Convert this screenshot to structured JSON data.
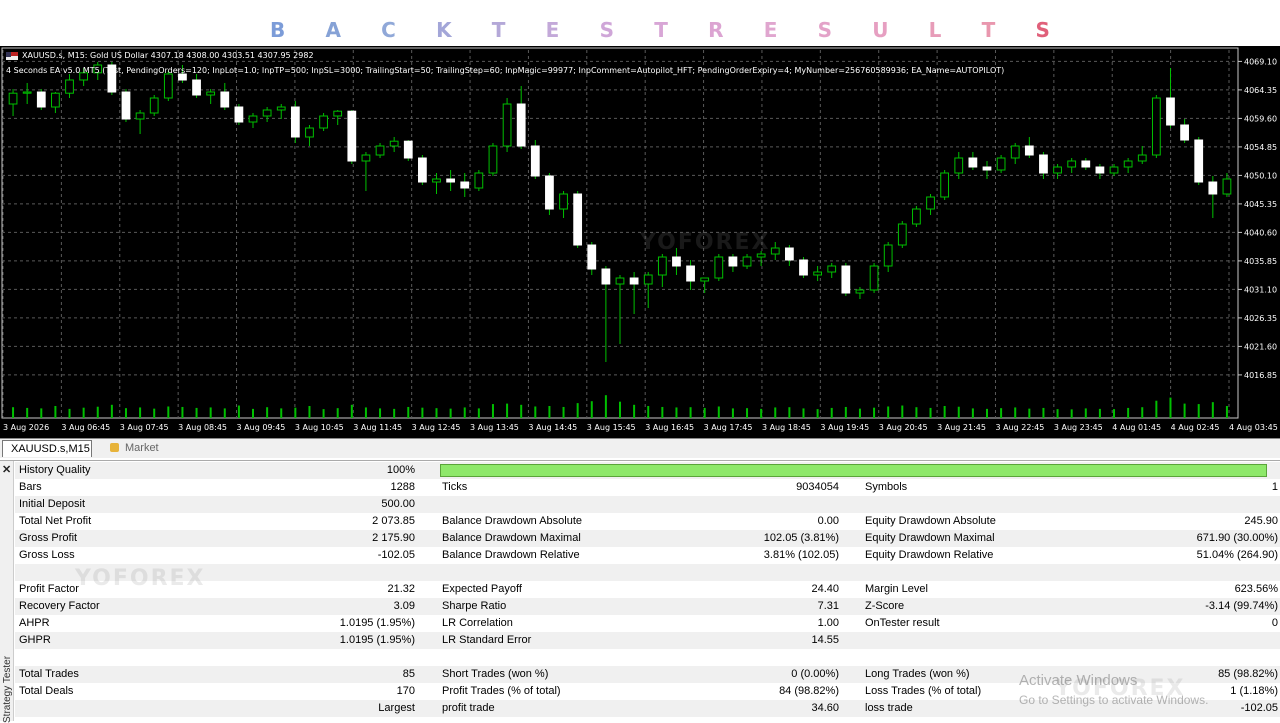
{
  "banner": {
    "letters": [
      "B",
      "A",
      "C",
      "K",
      "T",
      "E",
      "S",
      "T",
      "R",
      "E",
      "S",
      "U",
      "L",
      "T",
      "S"
    ],
    "colors": [
      "#7c9cd8",
      "#86a2d6",
      "#90a8d8",
      "#a3a6d8",
      "#b4a8d8",
      "#c3a9d9",
      "#cfa6d8",
      "#d8a6d6",
      "#dca4d2",
      "#e0a6cf",
      "#e3a2c8",
      "#e69fc1",
      "#e79cb8",
      "#e997ae",
      "#e0607a"
    ]
  },
  "chart_header": {
    "line1": "XAUUSD.s, M15:  Gold US Dollar  4307.18 4308.00 4303.51 4307.95  2982",
    "line2": "4 Seconds EA v5.0 MT5 (Test, PendingOrders=120; InpLot=1.0; InpTP=500; InpSL=3000; TrailingStart=50; TrailingStep=60; InpMagic=99977; InpComment=Autopilot_HFT; PendingOrderExpiry=4; MyNumber=256760589936; EA_Name=AUTOPILOT)"
  },
  "chart_data": {
    "type": "candlestick",
    "symbol": "XAUUSD.s",
    "timeframe": "M15",
    "ylim": [
      4014,
      4071
    ],
    "y_ticks": [
      "4069.10",
      "4064.35",
      "4059.60",
      "4054.85",
      "4050.10",
      "4045.35",
      "4040.60",
      "4035.85",
      "4031.10",
      "4026.35",
      "4021.60",
      "4016.85"
    ],
    "x_ticks": [
      "3 Aug 2026",
      "3 Aug 06:45",
      "3 Aug 07:45",
      "3 Aug 08:45",
      "3 Aug 09:45",
      "3 Aug 10:45",
      "3 Aug 11:45",
      "3 Aug 12:45",
      "3 Aug 13:45",
      "3 Aug 14:45",
      "3 Aug 15:45",
      "3 Aug 16:45",
      "3 Aug 17:45",
      "3 Aug 18:45",
      "3 Aug 19:45",
      "3 Aug 20:45",
      "3 Aug 21:45",
      "3 Aug 22:45",
      "3 Aug 23:45",
      "4 Aug 01:45",
      "4 Aug 02:45",
      "4 Aug 03:45"
    ],
    "bull_color": "#00c000",
    "bear_color": "#ffffff",
    "candles": [
      [
        4062.0,
        4064.5,
        4060.0,
        4063.8
      ],
      [
        4063.8,
        4065.5,
        4062.0,
        4064.0
      ],
      [
        4064.0,
        4064.5,
        4061.0,
        4061.5
      ],
      [
        4061.5,
        4064.0,
        4060.5,
        4063.8
      ],
      [
        4063.8,
        4067.0,
        4063.0,
        4066.0
      ],
      [
        4066.0,
        4068.0,
        4065.0,
        4067.2
      ],
      [
        4067.2,
        4069.0,
        4066.0,
        4068.5
      ],
      [
        4068.5,
        4069.0,
        4063.5,
        4064.0
      ],
      [
        4064.0,
        4064.5,
        4059.0,
        4059.5
      ],
      [
        4059.5,
        4061.0,
        4057.0,
        4060.5
      ],
      [
        4060.5,
        4063.5,
        4060.0,
        4063.0
      ],
      [
        4063.0,
        4067.5,
        4062.5,
        4067.0
      ],
      [
        4067.0,
        4068.5,
        4065.5,
        4066.0
      ],
      [
        4066.0,
        4067.0,
        4063.0,
        4063.5
      ],
      [
        4063.5,
        4064.5,
        4062.0,
        4064.0
      ],
      [
        4064.0,
        4065.5,
        4061.0,
        4061.5
      ],
      [
        4061.5,
        4062.0,
        4058.5,
        4059.0
      ],
      [
        4059.0,
        4060.5,
        4058.0,
        4060.0
      ],
      [
        4060.0,
        4061.5,
        4059.0,
        4061.0
      ],
      [
        4061.0,
        4062.0,
        4059.5,
        4061.5
      ],
      [
        4061.5,
        4062.5,
        4055.5,
        4056.5
      ],
      [
        4056.5,
        4058.5,
        4055.0,
        4058.0
      ],
      [
        4058.0,
        4060.5,
        4057.5,
        4060.0
      ],
      [
        4060.0,
        4061.0,
        4058.5,
        4060.8
      ],
      [
        4060.8,
        4061.0,
        4052.0,
        4052.5
      ],
      [
        4052.5,
        4054.0,
        4047.5,
        4053.5
      ],
      [
        4053.5,
        4055.5,
        4053.0,
        4055.0
      ],
      [
        4055.0,
        4056.5,
        4054.0,
        4055.8
      ],
      [
        4055.8,
        4056.0,
        4052.5,
        4053.0
      ],
      [
        4053.0,
        4053.5,
        4048.5,
        4049.0
      ],
      [
        4049.0,
        4050.5,
        4047.0,
        4049.5
      ],
      [
        4049.5,
        4051.0,
        4047.5,
        4049.0
      ],
      [
        4049.0,
        4050.5,
        4046.5,
        4048.0
      ],
      [
        4048.0,
        4051.0,
        4047.5,
        4050.5
      ],
      [
        4050.5,
        4055.5,
        4050.0,
        4055.0
      ],
      [
        4055.0,
        4063.0,
        4054.0,
        4062.0
      ],
      [
        4062.0,
        4065.0,
        4054.5,
        4055.0
      ],
      [
        4055.0,
        4056.0,
        4049.5,
        4050.0
      ],
      [
        4050.0,
        4050.5,
        4043.5,
        4044.5
      ],
      [
        4044.5,
        4047.5,
        4043.0,
        4047.0
      ],
      [
        4047.0,
        4047.5,
        4038.0,
        4038.5
      ],
      [
        4038.5,
        4039.0,
        4033.5,
        4034.5
      ],
      [
        4034.5,
        4035.0,
        4019.0,
        4032.0
      ],
      [
        4032.0,
        4033.5,
        4022.0,
        4033.0
      ],
      [
        4033.0,
        4034.0,
        4027.0,
        4032.0
      ],
      [
        4032.0,
        4034.0,
        4028.0,
        4033.5
      ],
      [
        4033.5,
        4037.0,
        4031.5,
        4036.5
      ],
      [
        4036.5,
        4038.0,
        4033.5,
        4035.0
      ],
      [
        4035.0,
        4036.0,
        4031.0,
        4032.5
      ],
      [
        4032.5,
        4033.0,
        4030.5,
        4033.0
      ],
      [
        4033.0,
        4037.0,
        4032.5,
        4036.5
      ],
      [
        4036.5,
        4037.0,
        4034.0,
        4035.0
      ],
      [
        4035.0,
        4037.0,
        4034.5,
        4036.5
      ],
      [
        4036.5,
        4037.5,
        4035.0,
        4037.0
      ],
      [
        4037.0,
        4039.0,
        4036.0,
        4038.0
      ],
      [
        4038.0,
        4038.5,
        4035.0,
        4036.0
      ],
      [
        4036.0,
        4036.5,
        4033.0,
        4033.5
      ],
      [
        4033.5,
        4035.0,
        4032.5,
        4034.0
      ],
      [
        4034.0,
        4035.5,
        4033.0,
        4035.0
      ],
      [
        4035.0,
        4035.5,
        4030.0,
        4030.5
      ],
      [
        4030.5,
        4031.5,
        4029.5,
        4031.0
      ],
      [
        4031.0,
        4035.5,
        4030.5,
        4035.0
      ],
      [
        4035.0,
        4039.0,
        4034.0,
        4038.5
      ],
      [
        4038.5,
        4042.5,
        4038.0,
        4042.0
      ],
      [
        4042.0,
        4045.0,
        4041.5,
        4044.5
      ],
      [
        4044.5,
        4047.0,
        4043.5,
        4046.5
      ],
      [
        4046.5,
        4051.0,
        4046.0,
        4050.5
      ],
      [
        4050.5,
        4054.0,
        4049.5,
        4053.0
      ],
      [
        4053.0,
        4054.0,
        4051.0,
        4051.5
      ],
      [
        4051.5,
        4052.5,
        4049.5,
        4051.0
      ],
      [
        4051.0,
        4053.5,
        4050.5,
        4053.0
      ],
      [
        4053.0,
        4055.5,
        4052.0,
        4055.0
      ],
      [
        4055.0,
        4056.5,
        4053.0,
        4053.5
      ],
      [
        4053.5,
        4054.0,
        4049.5,
        4050.5
      ],
      [
        4050.5,
        4052.0,
        4049.5,
        4051.5
      ],
      [
        4051.5,
        4053.0,
        4050.5,
        4052.5
      ],
      [
        4052.5,
        4053.0,
        4051.0,
        4051.5
      ],
      [
        4051.5,
        4052.0,
        4049.5,
        4050.5
      ],
      [
        4050.5,
        4052.0,
        4050.0,
        4051.5
      ],
      [
        4051.5,
        4053.0,
        4050.5,
        4052.5
      ],
      [
        4052.5,
        4055.0,
        4052.0,
        4053.5
      ],
      [
        4053.5,
        4063.5,
        4053.0,
        4063.0
      ],
      [
        4063.0,
        4068.0,
        4058.0,
        4058.5
      ],
      [
        4058.5,
        4059.5,
        4055.5,
        4056.0
      ],
      [
        4056.0,
        4056.5,
        4048.5,
        4049.0
      ],
      [
        4049.0,
        4050.0,
        4043.0,
        4047.0
      ],
      [
        4047.0,
        4050.5,
        4046.5,
        4049.5
      ]
    ],
    "volumes": [
      0.45,
      0.42,
      0.4,
      0.5,
      0.38,
      0.43,
      0.47,
      0.55,
      0.41,
      0.44,
      0.39,
      0.48,
      0.46,
      0.42,
      0.44,
      0.4,
      0.52,
      0.38,
      0.45,
      0.4,
      0.43,
      0.5,
      0.37,
      0.41,
      0.55,
      0.44,
      0.4,
      0.38,
      0.46,
      0.43,
      0.41,
      0.39,
      0.44,
      0.4,
      0.58,
      0.6,
      0.55,
      0.48,
      0.5,
      0.46,
      0.62,
      0.7,
      0.95,
      0.68,
      0.55,
      0.5,
      0.46,
      0.44,
      0.45,
      0.42,
      0.48,
      0.4,
      0.41,
      0.38,
      0.44,
      0.45,
      0.4,
      0.37,
      0.42,
      0.46,
      0.39,
      0.43,
      0.48,
      0.52,
      0.45,
      0.42,
      0.5,
      0.47,
      0.4,
      0.38,
      0.41,
      0.44,
      0.39,
      0.42,
      0.37,
      0.36,
      0.4,
      0.38,
      0.37,
      0.42,
      0.45,
      0.72,
      0.85,
      0.6,
      0.58,
      0.66,
      0.5
    ]
  },
  "tabs": {
    "active": "XAUUSD.s,M15",
    "market": "Market"
  },
  "side_label": "Strategy Tester",
  "rows": [
    {
      "l1": "History Quality",
      "v1": "100%",
      "bar": true
    },
    {
      "l1": "Bars",
      "v1": "1288",
      "l2": "Ticks",
      "v2": "9034054",
      "l3": "Symbols",
      "v3": "1"
    },
    {
      "l1": "Initial Deposit",
      "v1": "500.00"
    },
    {
      "l1": "Total Net Profit",
      "v1": "2 073.85",
      "l2": "Balance Drawdown Absolute",
      "v2": "0.00",
      "l3": "Equity Drawdown Absolute",
      "v3": "245.90"
    },
    {
      "l1": "Gross Profit",
      "v1": "2 175.90",
      "l2": "Balance Drawdown Maximal",
      "v2": "102.05 (3.81%)",
      "l3": "Equity Drawdown Maximal",
      "v3": "671.90 (30.00%)"
    },
    {
      "l1": "Gross Loss",
      "v1": "-102.05",
      "l2": "Balance Drawdown Relative",
      "v2": "3.81% (102.05)",
      "l3": "Equity Drawdown Relative",
      "v3": "51.04% (264.90)"
    },
    {},
    {
      "l1": "Profit Factor",
      "v1": "21.32",
      "l2": "Expected Payoff",
      "v2": "24.40",
      "l3": "Margin Level",
      "v3": "623.56%"
    },
    {
      "l1": "Recovery Factor",
      "v1": "3.09",
      "l2": "Sharpe Ratio",
      "v2": "7.31",
      "l3": "Z-Score",
      "v3": "-3.14 (99.74%)"
    },
    {
      "l1": "AHPR",
      "v1": "1.0195 (1.95%)",
      "l2": "LR Correlation",
      "v2": "1.00",
      "l3": "OnTester result",
      "v3": "0"
    },
    {
      "l1": "GHPR",
      "v1": "1.0195 (1.95%)",
      "l2": "LR Standard Error",
      "v2": "14.55"
    },
    {},
    {
      "l1": "Total Trades",
      "v1": "85",
      "l2": "Short Trades (won %)",
      "v2": "0 (0.00%)",
      "l3": "Long Trades (won %)",
      "v3": "85 (98.82%)"
    },
    {
      "l1": "Total Deals",
      "v1": "170",
      "l2": "Profit Trades (% of total)",
      "v2": "84 (98.82%)",
      "l3": "Loss Trades (% of total)",
      "v3": "1 (1.18%)"
    },
    {
      "v1": "Largest",
      "l2": "profit trade",
      "v2": "34.60",
      "l3": "loss trade",
      "v3": "-102.05"
    }
  ],
  "watermark": "YOFOREX",
  "activate": {
    "title": "Activate Windows",
    "subtitle": "Go to Settings to activate Windows."
  }
}
